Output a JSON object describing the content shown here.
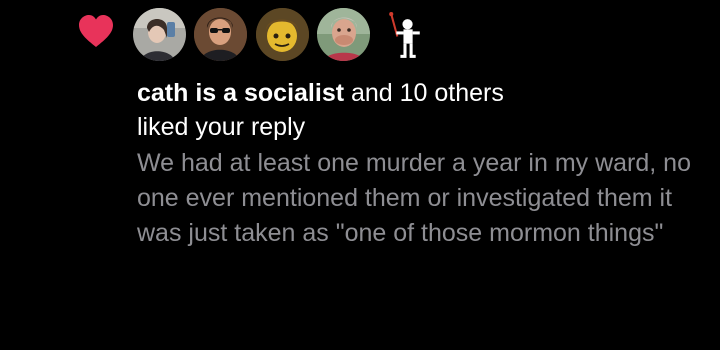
{
  "notification": {
    "type_icon": "heart-icon",
    "accent_color": "#e8335a",
    "actor_name": "cath is a socialist",
    "others_text": " and 10 others",
    "action_text": "liked your reply",
    "reply_text": "We had at least one murder a year in my ward, no one ever mentioned them or investigated them it was just taken as \"one of those mormon things\"",
    "avatars": [
      {
        "name": "avatar-1"
      },
      {
        "name": "avatar-2"
      },
      {
        "name": "avatar-3"
      },
      {
        "name": "avatar-4"
      },
      {
        "name": "avatar-5"
      }
    ]
  },
  "colors": {
    "background": "#000000",
    "primary_text": "#ffffff",
    "secondary_text": "#8e8e93"
  }
}
